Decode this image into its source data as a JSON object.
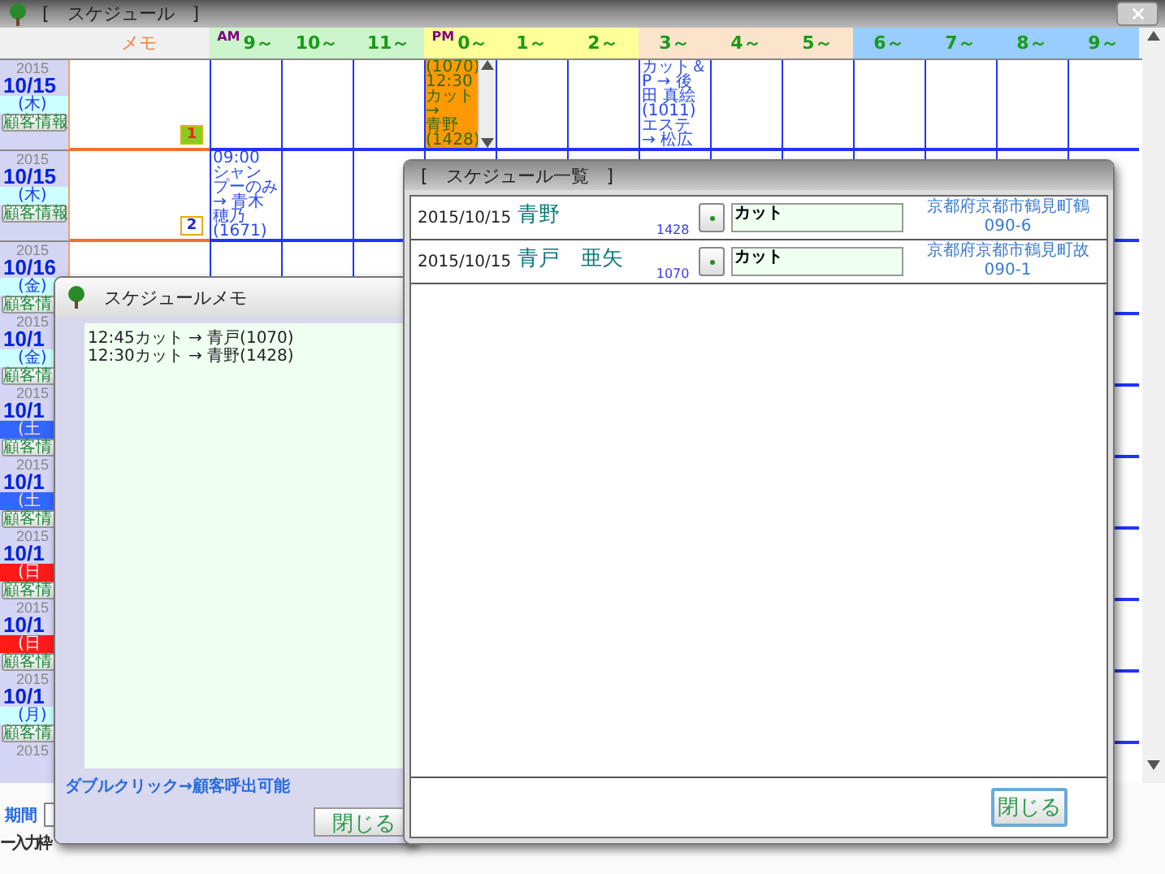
{
  "main_window": {
    "title": "[　スケジュール　]",
    "memo_label": "メモ",
    "period_label": "期間",
    "input_label": "ー入力枠"
  },
  "hours": [
    {
      "label": "9～",
      "color": "#ccf5cc",
      "prefix": "AM"
    },
    {
      "label": "10～",
      "color": "#ccf5cc"
    },
    {
      "label": "11～",
      "color": "#ccf5cc"
    },
    {
      "label": "0～",
      "color": "#ffff99",
      "prefix": "PM"
    },
    {
      "label": "1～",
      "color": "#ffff99"
    },
    {
      "label": "2～",
      "color": "#ffff99"
    },
    {
      "label": "3～",
      "color": "#fce4cc"
    },
    {
      "label": "4～",
      "color": "#fce4cc"
    },
    {
      "label": "5～",
      "color": "#fce4cc"
    },
    {
      "label": "6～",
      "color": "#99ccff"
    },
    {
      "label": "7～",
      "color": "#99ccff"
    },
    {
      "label": "8～",
      "color": "#99ccff"
    },
    {
      "label": "9～",
      "color": "#99ccff"
    }
  ],
  "days": [
    {
      "year": "2015",
      "date": "10/15",
      "weekday": "(木)",
      "kind": "weekday",
      "button": "顧客情報",
      "memo_badge": {
        "text": "1",
        "filled": true
      },
      "cells": [
        {
          "kind": "empty"
        },
        {
          "kind": "empty"
        },
        {
          "kind": "empty"
        },
        {
          "kind": "booking",
          "lines": [
            "(1070)",
            "12:30",
            "カット →",
            "青野",
            "(1428)"
          ]
        },
        {
          "kind": "empty"
        },
        {
          "kind": "empty"
        },
        {
          "kind": "note",
          "lines": [
            "カット＆",
            "P → 後",
            "田 真絵",
            "(1011)",
            "エステ",
            "→ 松広"
          ]
        },
        {
          "kind": "empty"
        },
        {
          "kind": "empty"
        },
        {
          "kind": "empty"
        },
        {
          "kind": "empty"
        },
        {
          "kind": "empty"
        },
        {
          "kind": "empty"
        }
      ]
    },
    {
      "year": "2015",
      "date": "10/15",
      "weekday": "(木)",
      "kind": "weekday",
      "button": "顧客情報",
      "memo_badge": {
        "text": "2",
        "filled": false
      },
      "cells": [
        {
          "kind": "note",
          "lines": [
            "09:00",
            "シャン",
            "プーのみ",
            "→ 青木",
            "穂乃",
            "(1671)"
          ]
        },
        {
          "kind": "empty"
        },
        {
          "kind": "empty"
        },
        {
          "kind": "empty"
        },
        {
          "kind": "empty"
        },
        {
          "kind": "empty"
        },
        {
          "kind": "empty"
        },
        {
          "kind": "empty"
        },
        {
          "kind": "empty"
        },
        {
          "kind": "empty"
        },
        {
          "kind": "empty"
        },
        {
          "kind": "empty"
        },
        {
          "kind": "empty"
        }
      ]
    },
    {
      "year": "2015",
      "date": "10/16",
      "weekday": "(金)",
      "kind": "weekday",
      "button": "顧客情"
    },
    {
      "year": "2015",
      "date": "10/1",
      "weekday": "(金)",
      "kind": "weekday",
      "button": "顧客情"
    },
    {
      "year": "2015",
      "date": "10/1",
      "weekday": "(土",
      "kind": "saturday",
      "button": "顧客情"
    },
    {
      "year": "2015",
      "date": "10/1",
      "weekday": "(土",
      "kind": "saturday",
      "button": "顧客情"
    },
    {
      "year": "2015",
      "date": "10/1",
      "weekday": "(日",
      "kind": "sunday",
      "button": "顧客情"
    },
    {
      "year": "2015",
      "date": "10/1",
      "weekday": "(日",
      "kind": "sunday",
      "button": "顧客情"
    },
    {
      "year": "2015",
      "date": "10/1",
      "weekday": "(月)",
      "kind": "weekday",
      "button": "顧客情"
    },
    {
      "year": "2015"
    }
  ],
  "memo_window": {
    "title": "スケジュールメモ",
    "lines": [
      "12:45カット → 青戸(1070)",
      "12:30カット → 青野(1428)"
    ],
    "hint": "ダブルクリック→顧客呼出可能",
    "close_button": "閉じる"
  },
  "list_window": {
    "title": "[　スケジュール一覧　]",
    "rows": [
      {
        "date": "2015/10/15",
        "name": "青野",
        "id": "1428",
        "menu": "カット",
        "address": "京都府京都市鶴見町鶴",
        "phone": "090-6"
      },
      {
        "date": "2015/10/15",
        "name": "青戸　亜矢",
        "id": "1070",
        "menu": "カット",
        "address": "京都府京都市鶴見町故",
        "phone": "090-1"
      }
    ],
    "close_button": "閉じる"
  }
}
